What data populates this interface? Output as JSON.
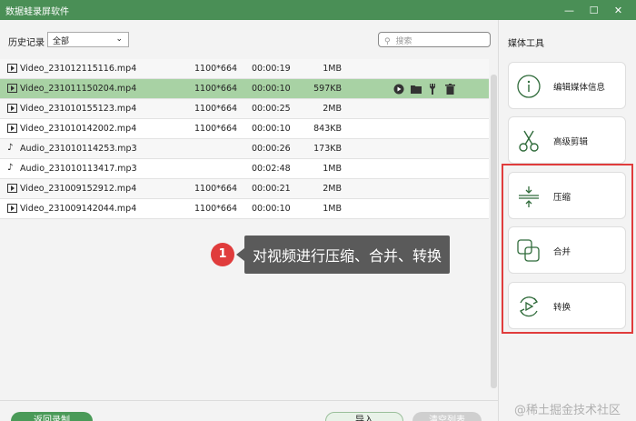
{
  "window": {
    "title": "数据蛙录屏软件",
    "controls": [
      "—",
      "☐",
      "✕"
    ]
  },
  "toolbar": {
    "history_label": "历史记录",
    "filter_value": "全部",
    "search_placeholder": "搜索"
  },
  "files": [
    {
      "name": "Video_231012115116.mp4",
      "type": "video",
      "resolution": "1100*664",
      "duration": "00:00:19",
      "size": "1MB"
    },
    {
      "name": "Video_231011150204.mp4",
      "type": "video",
      "resolution": "1100*664",
      "duration": "00:00:10",
      "size": "597KB",
      "selected": true
    },
    {
      "name": "Video_231010155123.mp4",
      "type": "video",
      "resolution": "1100*664",
      "duration": "00:00:25",
      "size": "2MB"
    },
    {
      "name": "Video_231010142002.mp4",
      "type": "video",
      "resolution": "1100*664",
      "duration": "00:00:10",
      "size": "843KB"
    },
    {
      "name": "Audio_231010114253.mp3",
      "type": "audio",
      "resolution": "",
      "duration": "00:00:26",
      "size": "173KB"
    },
    {
      "name": "Audio_231010113417.mp3",
      "type": "audio",
      "resolution": "",
      "duration": "00:02:48",
      "size": "1MB"
    },
    {
      "name": "Video_231009152912.mp4",
      "type": "video",
      "resolution": "1100*664",
      "duration": "00:00:21",
      "size": "2MB"
    },
    {
      "name": "Video_231009142044.mp4",
      "type": "video",
      "resolution": "1100*664",
      "duration": "00:00:10",
      "size": "1MB"
    }
  ],
  "row_actions": [
    "play-icon",
    "folder-icon",
    "tools-icon",
    "trash-icon"
  ],
  "callout": {
    "number": "1",
    "text": "对视频进行压缩、合并、转换"
  },
  "bottom": {
    "back_label": "返回录制",
    "import_label": "导入",
    "clear_label": "清空列表"
  },
  "media_tools": {
    "title": "媒体工具",
    "items": [
      {
        "label": "编辑媒体信息",
        "icon": "info-icon"
      },
      {
        "label": "高级剪辑",
        "icon": "scissors-icon"
      },
      {
        "label": "压缩",
        "icon": "compress-icon"
      },
      {
        "label": "合并",
        "icon": "merge-icon"
      },
      {
        "label": "转换",
        "icon": "convert-icon"
      }
    ]
  },
  "watermark": "@稀土掘金技术社区",
  "colors": {
    "accent": "#4a8f56",
    "selected_row": "#a8d2a4",
    "highlight": "#e03c3c"
  }
}
